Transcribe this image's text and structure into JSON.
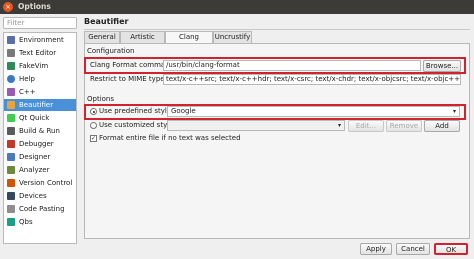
{
  "window": {
    "title": "Options",
    "close_glyph": "×"
  },
  "filter": {
    "placeholder": "Filter"
  },
  "sidebar": {
    "items": [
      {
        "label": "Environment",
        "icon": "monitor-icon",
        "color": "#5a6fa8"
      },
      {
        "label": "Text Editor",
        "icon": "text-editor-icon",
        "color": "#7a7a7a"
      },
      {
        "label": "FakeVim",
        "icon": "fakevim-icon",
        "color": "#2e8b57"
      },
      {
        "label": "Help",
        "icon": "help-icon",
        "color": "#3b78c4"
      },
      {
        "label": "C++",
        "icon": "cpp-icon",
        "color": "#9b59b6"
      },
      {
        "label": "Beautifier",
        "icon": "beautifier-icon",
        "color": "#e8a33d",
        "active": true
      },
      {
        "label": "Qt Quick",
        "icon": "qt-quick-icon",
        "color": "#41cd52"
      },
      {
        "label": "Build & Run",
        "icon": "build-run-icon",
        "color": "#5a5a5a"
      },
      {
        "label": "Debugger",
        "icon": "debugger-icon",
        "color": "#c0392b"
      },
      {
        "label": "Designer",
        "icon": "designer-icon",
        "color": "#4a7bbd"
      },
      {
        "label": "Analyzer",
        "icon": "analyzer-icon",
        "color": "#6d8a3a"
      },
      {
        "label": "Version Control",
        "icon": "version-control-icon",
        "color": "#d35400"
      },
      {
        "label": "Devices",
        "icon": "devices-icon",
        "color": "#34495e"
      },
      {
        "label": "Code Pasting",
        "icon": "code-pasting-icon",
        "color": "#8e8e8e"
      },
      {
        "label": "Qbs",
        "icon": "qbs-icon",
        "color": "#16a085"
      }
    ]
  },
  "page": {
    "title": "Beautifier"
  },
  "tabs": [
    {
      "label": "General"
    },
    {
      "label": "Artistic Style"
    },
    {
      "label": "Clang Format",
      "active": true
    },
    {
      "label": "Uncrustify"
    }
  ],
  "configuration": {
    "section_label": "Configuration",
    "command_label": "Clang Format command:",
    "command_value": "/usr/bin/clang-format",
    "browse_label": "Browse...",
    "mime_label": "Restrict to MIME types:",
    "mime_value": "text/x-c++src; text/x-c++hdr; text/x-csrc; text/x-chdr; text/x-objcsrc; text/x-objc++src"
  },
  "options": {
    "section_label": "Options",
    "predefined_label": "Use predefined style:",
    "predefined_value": "Google",
    "predefined_selected": true,
    "customized_label": "Use customized style:",
    "customized_selected": false,
    "edit_label": "Edit...",
    "remove_label": "Remove",
    "add_label": "Add",
    "format_entire_label": "Format entire file if no text was selected",
    "format_entire_checked": true,
    "check_glyph": "✓",
    "dropdown_glyph": "▾"
  },
  "footer": {
    "apply_label": "Apply",
    "cancel_label": "Cancel",
    "ok_label": "OK"
  },
  "colors": {
    "accent": "#4a90d9",
    "highlight": "#d2222d",
    "titlebar": "#3c3b37",
    "close": "#e95420"
  }
}
